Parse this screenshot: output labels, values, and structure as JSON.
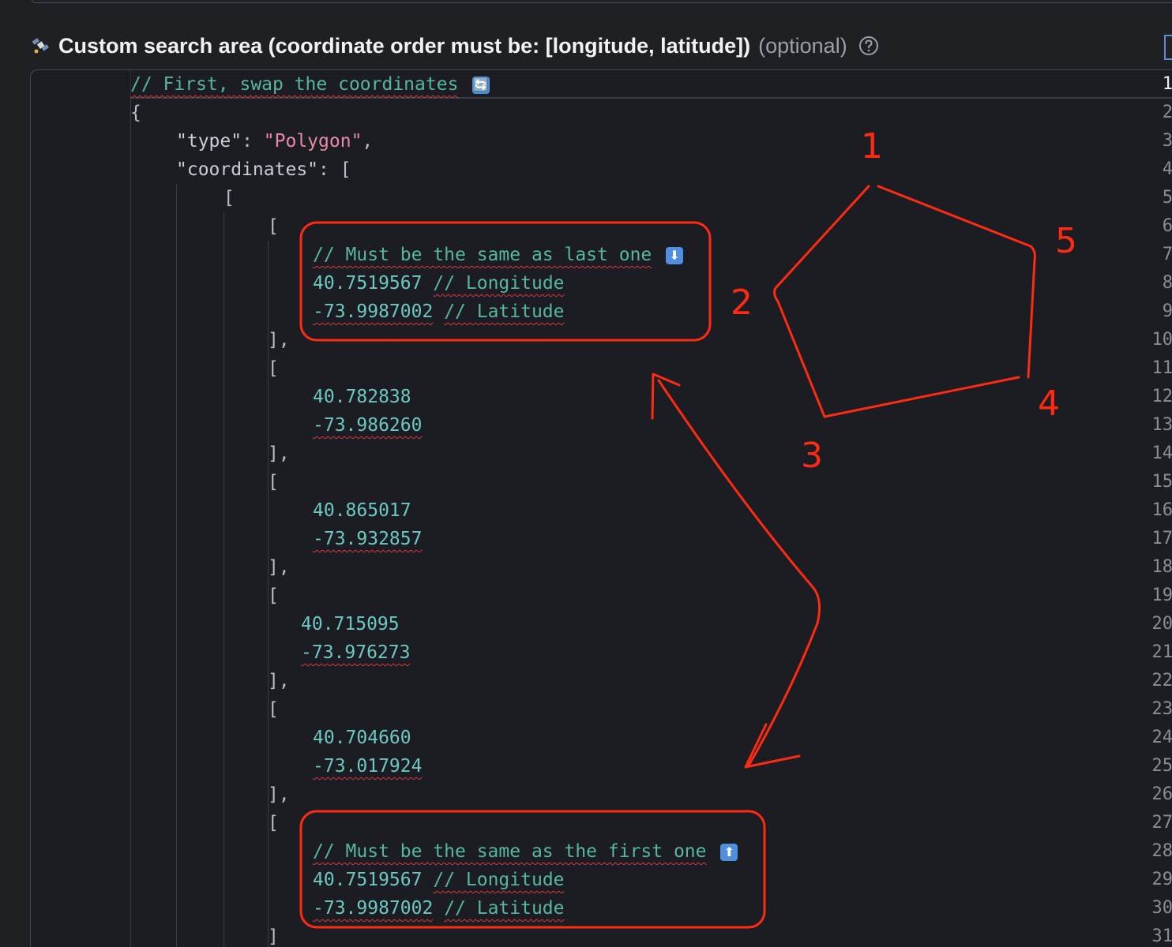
{
  "field": {
    "label": "Custom search area (coordinate order must be: [longitude, latitude])",
    "optional": "(optional)",
    "label_icon": "satellite-icon",
    "help_icon": "question-circle-icon"
  },
  "editor": {
    "active_line": 1,
    "lines": [
      {
        "n": "1"
      },
      {
        "n": "2"
      },
      {
        "n": "3"
      },
      {
        "n": "4"
      },
      {
        "n": "5"
      },
      {
        "n": "6"
      },
      {
        "n": "7"
      },
      {
        "n": "8"
      },
      {
        "n": "9"
      },
      {
        "n": "10"
      },
      {
        "n": "11"
      },
      {
        "n": "12"
      },
      {
        "n": "13"
      },
      {
        "n": "14"
      },
      {
        "n": "15"
      },
      {
        "n": "16"
      },
      {
        "n": "17"
      },
      {
        "n": "18"
      },
      {
        "n": "19"
      },
      {
        "n": "20"
      },
      {
        "n": "21"
      },
      {
        "n": "22"
      },
      {
        "n": "23"
      },
      {
        "n": "24"
      },
      {
        "n": "25"
      },
      {
        "n": "26"
      },
      {
        "n": "27"
      },
      {
        "n": "28"
      },
      {
        "n": "29"
      },
      {
        "n": "30"
      },
      {
        "n": "31"
      }
    ],
    "code": {
      "l1": "// First, swap the coordinates",
      "l2": "{",
      "l3_key": "\"type\"",
      "l3_colon": ": ",
      "l3_val": "\"Polygon\"",
      "l3_end": ",",
      "l4_key": "\"coordinates\"",
      "l4_rest": ": [",
      "l5": "[",
      "l6": "[",
      "l7": "// Must be the same as last one",
      "l8_num": "40.7519567",
      "l8_comment": "// Longitude",
      "l9_num": "-73.9987002",
      "l9_comment": "// Latitude",
      "l10": "],",
      "l11": "[",
      "l12": "40.782838",
      "l13": "-73.986260",
      "l14": "],",
      "l15": "[",
      "l16": "40.865017",
      "l17": "-73.932857",
      "l18": "],",
      "l19": "[",
      "l20": "40.715095",
      "l21": "-73.976273",
      "l22": "],",
      "l23": "[",
      "l24": "40.704660",
      "l25": "-73.017924",
      "l26": "],",
      "l27": "[",
      "l28": "// Must be the same as the first one",
      "l29_num": "40.7519567",
      "l29_comment": "// Longitude",
      "l30_num": "-73.9987002",
      "l30_comment": "// Latitude",
      "l31": "]"
    },
    "emoji": {
      "swap": "🔄",
      "down": "⬇",
      "up": "⬆"
    }
  },
  "annotation": {
    "color": "#ff2a12",
    "vertex_labels": [
      "1",
      "2",
      "3",
      "4",
      "5"
    ]
  }
}
